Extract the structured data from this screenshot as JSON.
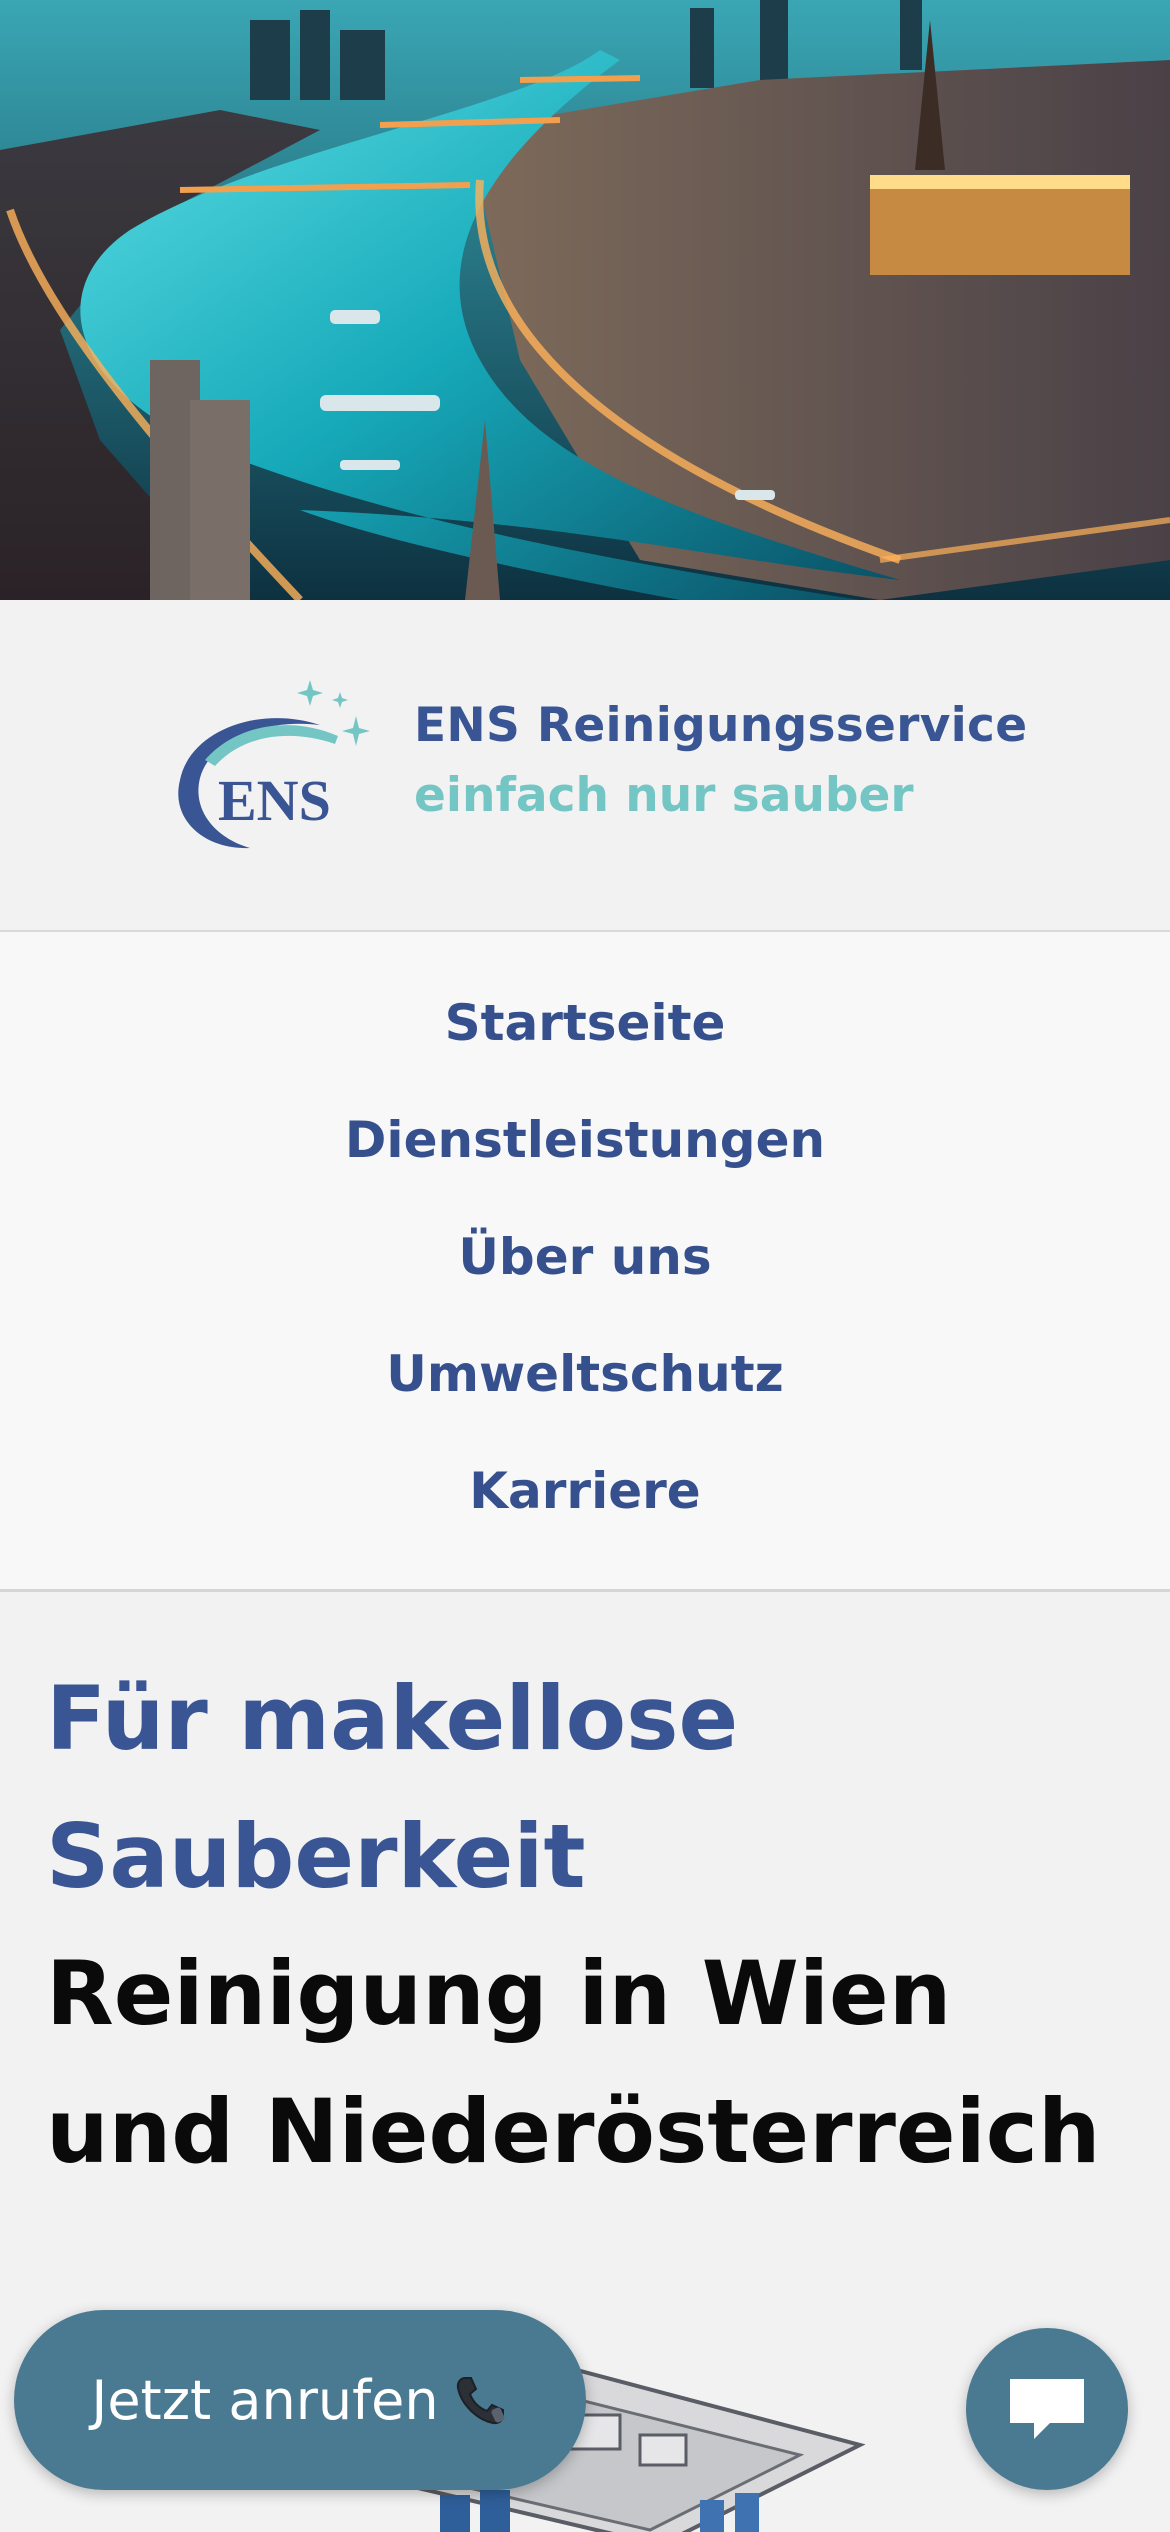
{
  "brand": {
    "logo_text": "ENS",
    "name": "ENS Reinigungsservice",
    "tagline": "einfach nur sauber",
    "colors": {
      "primary": "#3a5593",
      "accent": "#73c6c4"
    }
  },
  "nav": {
    "items": [
      {
        "label": "Startseite"
      },
      {
        "label": "Dienstleistungen"
      },
      {
        "label": "Über uns"
      },
      {
        "label": "Umweltschutz"
      },
      {
        "label": "Karriere"
      }
    ]
  },
  "main": {
    "headline_line1": "Für makellose",
    "headline_line2": "Sauberkeit",
    "subheadline_line1": "Reinigung in Wien",
    "subheadline_line2": "und Niederösterreich"
  },
  "actions": {
    "call_label": "Jetzt anrufen",
    "call_icon": "phone-icon",
    "chat_icon": "chat-bubble-icon",
    "button_color": "#4a7a92"
  }
}
